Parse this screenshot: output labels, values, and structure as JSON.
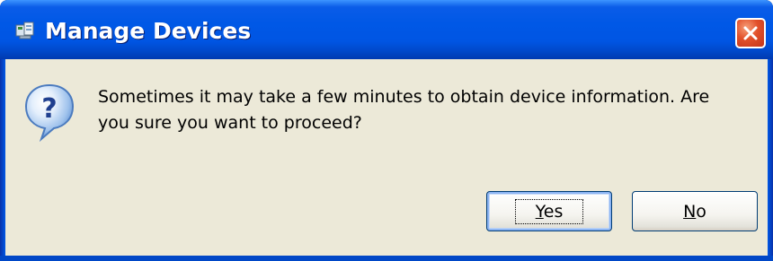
{
  "window": {
    "title": "Manage Devices"
  },
  "dialog": {
    "message": "Sometimes it may take a few minutes to obtain device information. Are you sure you want to proceed?"
  },
  "buttons": {
    "yes": {
      "mnemonic": "Y",
      "rest": "es"
    },
    "no": {
      "mnemonic": "N",
      "rest": "o"
    }
  },
  "icons": {
    "title_icon": "manage-devices-app-icon",
    "close": "close-icon",
    "message_icon": "question-icon"
  },
  "colors": {
    "titlebar": "#0058e6",
    "client_background": "#ece9d8",
    "close_button": "#e2502a",
    "default_button_highlight": "#8cb4f2"
  }
}
